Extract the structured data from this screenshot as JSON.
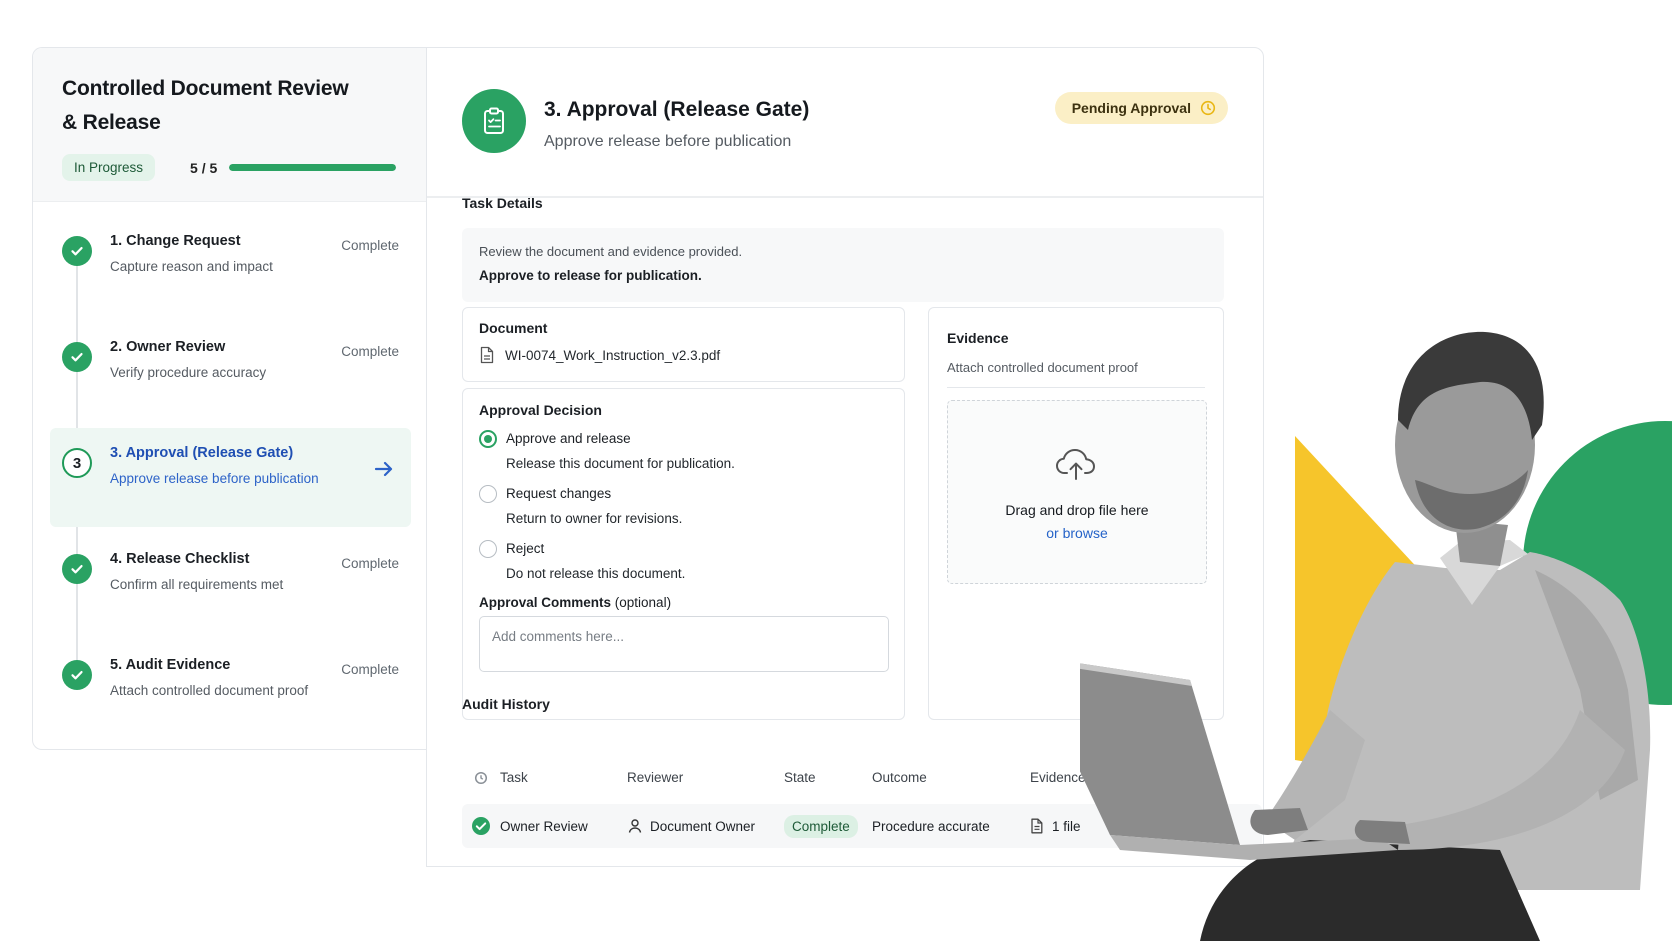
{
  "workflow": {
    "title_line1": "Controlled Document Review",
    "title_line2": "& Release",
    "status": "In Progress",
    "progress_text": "5 / 5",
    "progress_fraction": 1.0,
    "accent": "#2aa263",
    "steps": [
      {
        "name": "1. Change Request",
        "desc": "Capture reason and impact",
        "state": "Complete"
      },
      {
        "name": "2. Owner Review",
        "desc": "Verify procedure accuracy",
        "state": "Complete"
      },
      {
        "name": "3. Approval (Release Gate)",
        "desc": "Approve release before publication",
        "number": "3"
      },
      {
        "name": "4. Release Checklist",
        "desc": "Confirm all requirements met",
        "state": "Complete"
      },
      {
        "name": "5. Audit Evidence",
        "desc": "Attach controlled document proof",
        "state": "Complete"
      }
    ]
  },
  "main": {
    "title": "3. Approval (Release Gate)",
    "subtitle": "Approve release before publication",
    "badge": "Pending Approval",
    "badge_color": "#fbefc6",
    "task_details": {
      "label": "Task Details",
      "line1": "Review the document and evidence provided.",
      "line2": "Approve to release for publication."
    },
    "document": {
      "label": "Document",
      "file": "WI-0074_Work_Instruction_v2.3.pdf"
    },
    "decision": {
      "label": "Approval Decision",
      "options": [
        {
          "label": "Approve and release",
          "help": "Release this document for publication.",
          "selected": true
        },
        {
          "label": "Request changes",
          "help": "Return to owner for revisions.",
          "selected": false
        },
        {
          "label": "Reject",
          "help": "Do not release this document.",
          "selected": false
        }
      ],
      "comments_label": "Approval Comments",
      "comments_optional": " (optional)",
      "comments_placeholder": "Add comments here..."
    },
    "evidence": {
      "label": "Evidence",
      "sub": "Attach controlled document proof",
      "drop_text": "Drag and drop file here",
      "browse": "or browse"
    },
    "audit": {
      "label": "Audit History",
      "columns": [
        "Task",
        "Reviewer",
        "State",
        "Outcome",
        "Evidence"
      ],
      "rows": [
        {
          "task": "Owner Review",
          "reviewer": "Document Owner",
          "state": "Complete",
          "outcome": "Procedure accurate",
          "evidence": "1 file"
        }
      ]
    }
  },
  "hero": {
    "shape_colors": [
      "#f6c52b",
      "#2aa263"
    ]
  }
}
